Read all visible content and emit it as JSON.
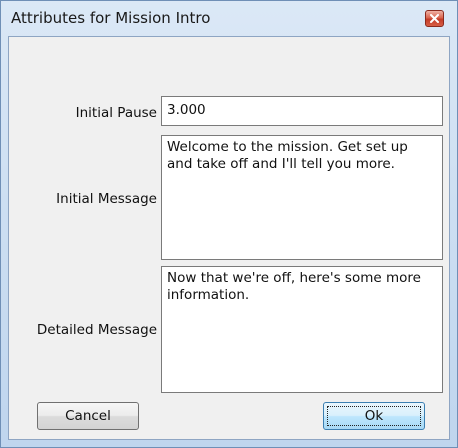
{
  "dialog": {
    "title": "Attributes for Mission Intro",
    "close_icon": "close-x-icon"
  },
  "fields": {
    "initial_pause": {
      "label": "Initial Pause",
      "value": "3.000"
    },
    "initial_message": {
      "label": "Initial Message",
      "value": "Welcome to the mission. Get set up and take off and I'll tell you more."
    },
    "detailed_message": {
      "label": "Detailed Message",
      "value": "Now that we're off, here's some more information."
    }
  },
  "buttons": {
    "cancel": "Cancel",
    "ok": "Ok"
  },
  "colors": {
    "close_button": "#c43c28",
    "default_button_border": "#3c7fb1"
  }
}
